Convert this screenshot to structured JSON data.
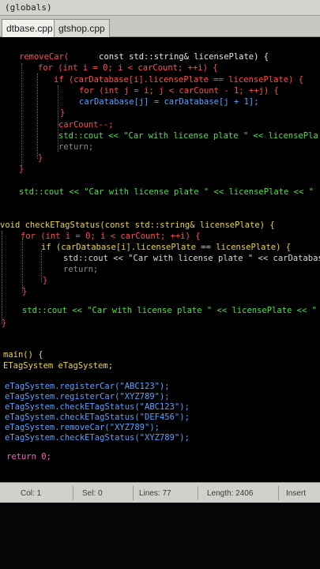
{
  "scope": {
    "label": "(globals)"
  },
  "tabs": [
    {
      "label": "dtbase.cpp",
      "active": true
    },
    {
      "label": "gtshop.cpp",
      "active": false
    }
  ],
  "code": {
    "remove_fn_sig": "removeCar(",
    "remove_fn_sig_rest": "const std::string& licensePlate) {",
    "for_outer": "for (int i = 0; i < carCount; ++i) {",
    "if_match": "if (carDatabase[i].licensePlate == licensePlate) {",
    "for_inner": "for (int j = i; j < carCount - 1; ++j) {",
    "assign": "carDatabase[j] = carDatabase[j + 1];",
    "close_brace": "}",
    "decrement": "carCount--;",
    "cout_removed_prefix": "std::cout << \"Car with license plate \" << licensePla",
    "return_stmt": "return;",
    "cout_not_found_a": "std::cout << \"Car with license plate \" << licensePlate << \"",
    "check_fn_sig": "void checkETagStatus(const std::string& licensePlate) {",
    "check_for": "for (int i = 0; i < carCount; ++i) {",
    "check_if": "if (carDatabase[i].licensePlate == licensePlate) {",
    "check_cout": "std::cout << \"Car with license plate \" << carDatabas",
    "check_return": "return;",
    "cout_not_found_b": "std::cout << \"Car with license plate \" << licensePlate << \" n",
    "main_sig": "main() {",
    "system_decl": "ETagSystem eTagSystem;",
    "call_1": "eTagSystem.registerCar(\"ABC123\");",
    "call_2": "eTagSystem.registerCar(\"XYZ789\");",
    "call_3": "eTagSystem.checkETagStatus(\"ABC123\");",
    "call_4": "eTagSystem.checkETagStatus(\"DEF456\");",
    "call_5": "eTagSystem.removeCar(\"XYZ789\");",
    "call_6": "eTagSystem.checkETagStatus(\"XYZ789\");",
    "return_zero": "return 0;"
  },
  "status": {
    "col_label": "Col:",
    "col_value": "1",
    "sel_label": "Sel:",
    "sel_value": "0",
    "lines_label": "Lines:",
    "lines_value": "77",
    "length_label": "Length:",
    "length_value": "2406",
    "mode": "Insert"
  },
  "colors": {
    "keyword": "#5aa2ff",
    "function": "#e8d44d",
    "symbol": "#ff4d4d",
    "number": "#ff5cc8",
    "stream": "#4de04d",
    "editor_bg": "#000000"
  }
}
